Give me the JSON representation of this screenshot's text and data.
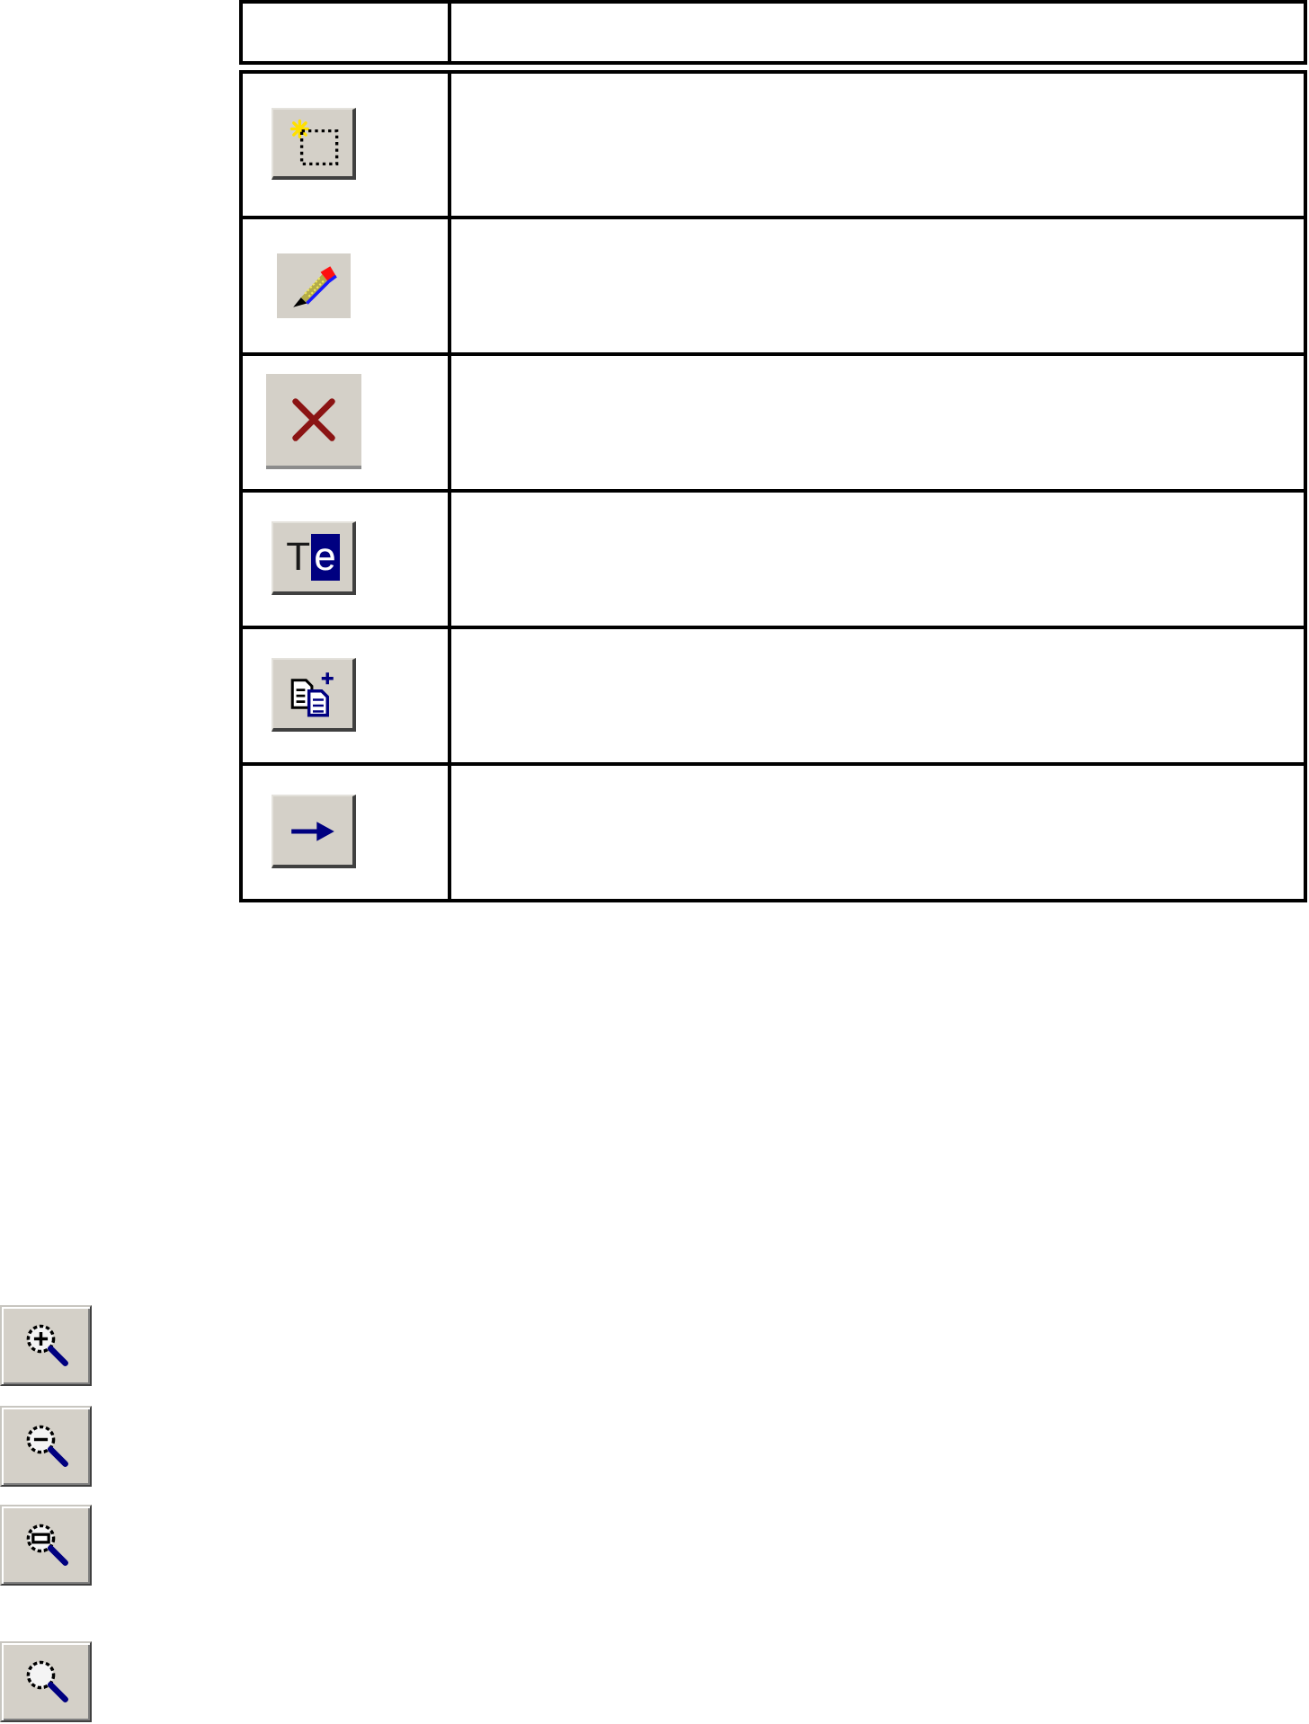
{
  "table": {
    "rows": [
      {
        "kind": "selection"
      },
      {
        "kind": "pen"
      },
      {
        "kind": "delete"
      },
      {
        "kind": "text",
        "letters": [
          {
            "text": "T",
            "selected": false
          },
          {
            "text": "e",
            "selected": true
          }
        ]
      },
      {
        "kind": "copy"
      },
      {
        "kind": "arrow"
      }
    ]
  },
  "zoom_buttons": [
    {
      "kind": "zoom-in"
    },
    {
      "kind": "zoom-out"
    },
    {
      "kind": "zoom-bar"
    },
    {
      "kind": "magnifier"
    }
  ]
}
